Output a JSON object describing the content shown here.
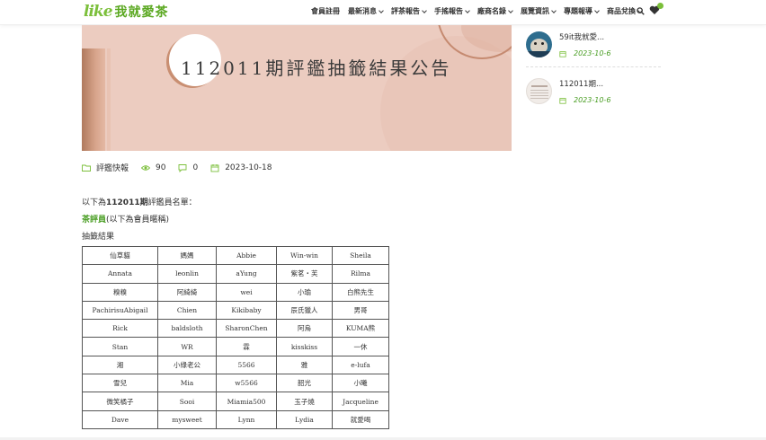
{
  "header": {
    "logo_mark": "like",
    "logo_text": "我就愛茶",
    "nav": [
      {
        "label": "會員註冊",
        "has_menu": false
      },
      {
        "label": "最新消息",
        "has_menu": true
      },
      {
        "label": "評茶報告",
        "has_menu": true
      },
      {
        "label": "手搖報告",
        "has_menu": true
      },
      {
        "label": "廠商名錄",
        "has_menu": true
      },
      {
        "label": "展覽資訊",
        "has_menu": true
      },
      {
        "label": "專題報導",
        "has_menu": true
      },
      {
        "label": "商品兌換",
        "has_menu": true
      }
    ],
    "icons": [
      "search-icon",
      "heart-icon"
    ],
    "accent": "#7bbf3a"
  },
  "banner": {
    "title": "112011期評鑑抽籤結果公告"
  },
  "meta": {
    "category": "評鑑快報",
    "views": "90",
    "comments": "0",
    "date": "2023-10-18"
  },
  "content": {
    "intro_prefix": "以下為",
    "intro_bold": "112011期",
    "intro_suffix": "評鑑員名單：",
    "tasters_label": "茶評員",
    "tasters_note": "(以下為會員暱稱)",
    "results_label": "抽籤結果",
    "table": [
      [
        "仙草貓",
        "媽媽",
        "Abbie",
        "Win-win",
        "Sheila"
      ],
      [
        "Annata",
        "leonlin",
        "aYung",
        "紫茗・芙",
        "Rilma"
      ],
      [
        "糗糗",
        "阿綺綺",
        "wei",
        "小瑜",
        "白熊先生"
      ],
      [
        "PachirisuAbigail",
        "Chien",
        "Kikibaby",
        "辰氏獵人",
        "男哥"
      ],
      [
        "Rick",
        "baldsloth",
        "SharonChen",
        "阿烏",
        "KUMA熊"
      ],
      [
        "Stan",
        "WR",
        "霖",
        "kisskiss",
        "一休"
      ],
      [
        "湘",
        "小綠老公",
        "5566",
        "雅",
        "e-lufa"
      ],
      [
        "雪兒",
        "Mia",
        "w5566",
        "韶光",
        "小曦"
      ],
      [
        "微笑橘子",
        "Sooi",
        "Miamia500",
        "玉子燒",
        "Jacqueline"
      ],
      [
        "Dave",
        "mysweet",
        "Lynn",
        "Lydia",
        "就愛喝"
      ]
    ]
  },
  "sidebar": {
    "posts": [
      {
        "title": "59it我就愛...",
        "date": "2023-10-6"
      },
      {
        "title": "112011期...",
        "date": "2023-10-6"
      }
    ]
  }
}
